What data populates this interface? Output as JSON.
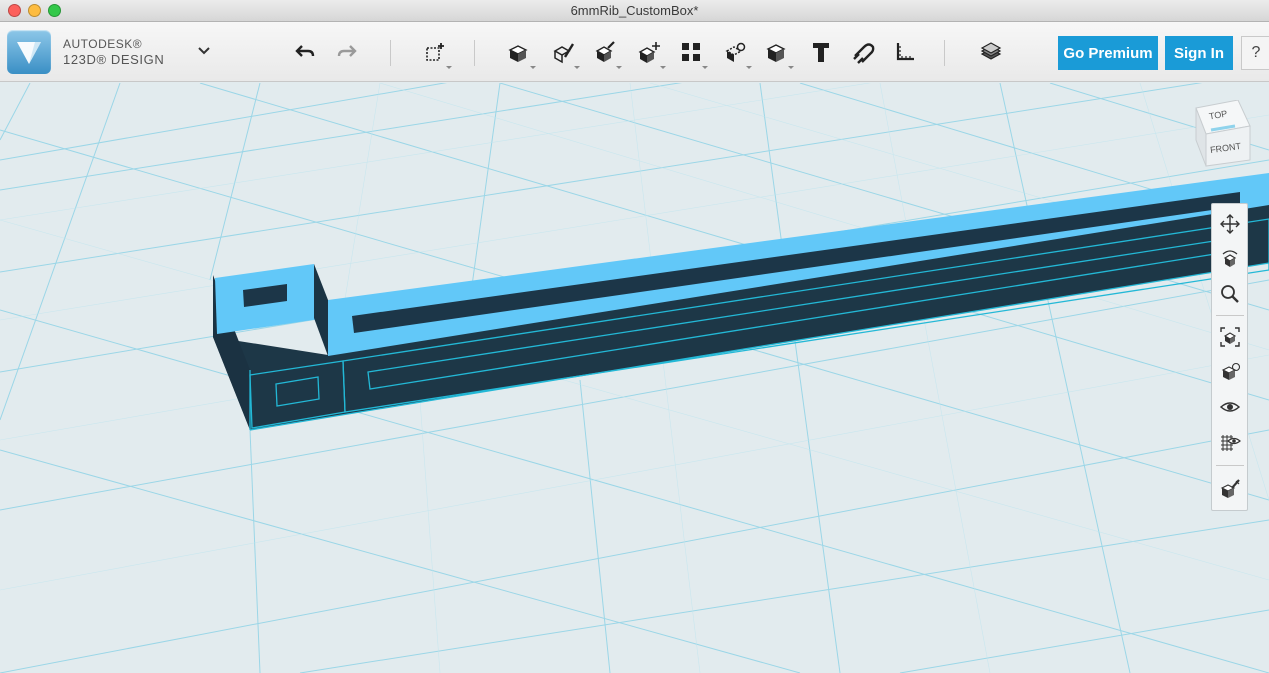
{
  "window": {
    "title": "6mmRib_CustomBox*"
  },
  "app": {
    "brand_line1": "AUTODESK®",
    "brand_line2": "123D® DESIGN"
  },
  "toolbar": {
    "premium_label": "Go Premium",
    "signin_label": "Sign In",
    "help_label": "?",
    "tools": [
      "undo-icon",
      "redo-icon",
      "primitives-icon",
      "sketch-icon",
      "construct-icon",
      "modify-icon",
      "pattern-icon",
      "grouping-icon",
      "combine-icon",
      "measure-icon",
      "text-icon",
      "snap-icon",
      "ruler-icon",
      "material-icon"
    ]
  },
  "viewcube": {
    "top_label": "TOP",
    "front_label": "FRONT"
  },
  "navbar": {
    "tools": [
      "pan-icon",
      "orbit-icon",
      "zoom-icon",
      "fit-icon",
      "view-mode-icon",
      "visibility-icon",
      "grid-icon",
      "material-toggle-icon"
    ]
  },
  "colors": {
    "accent": "#1a9bd7",
    "model_top": "#5dc6f7",
    "model_side": "#1c3648",
    "grid": "#6ec8e2",
    "canvas": "#e2ebee"
  }
}
